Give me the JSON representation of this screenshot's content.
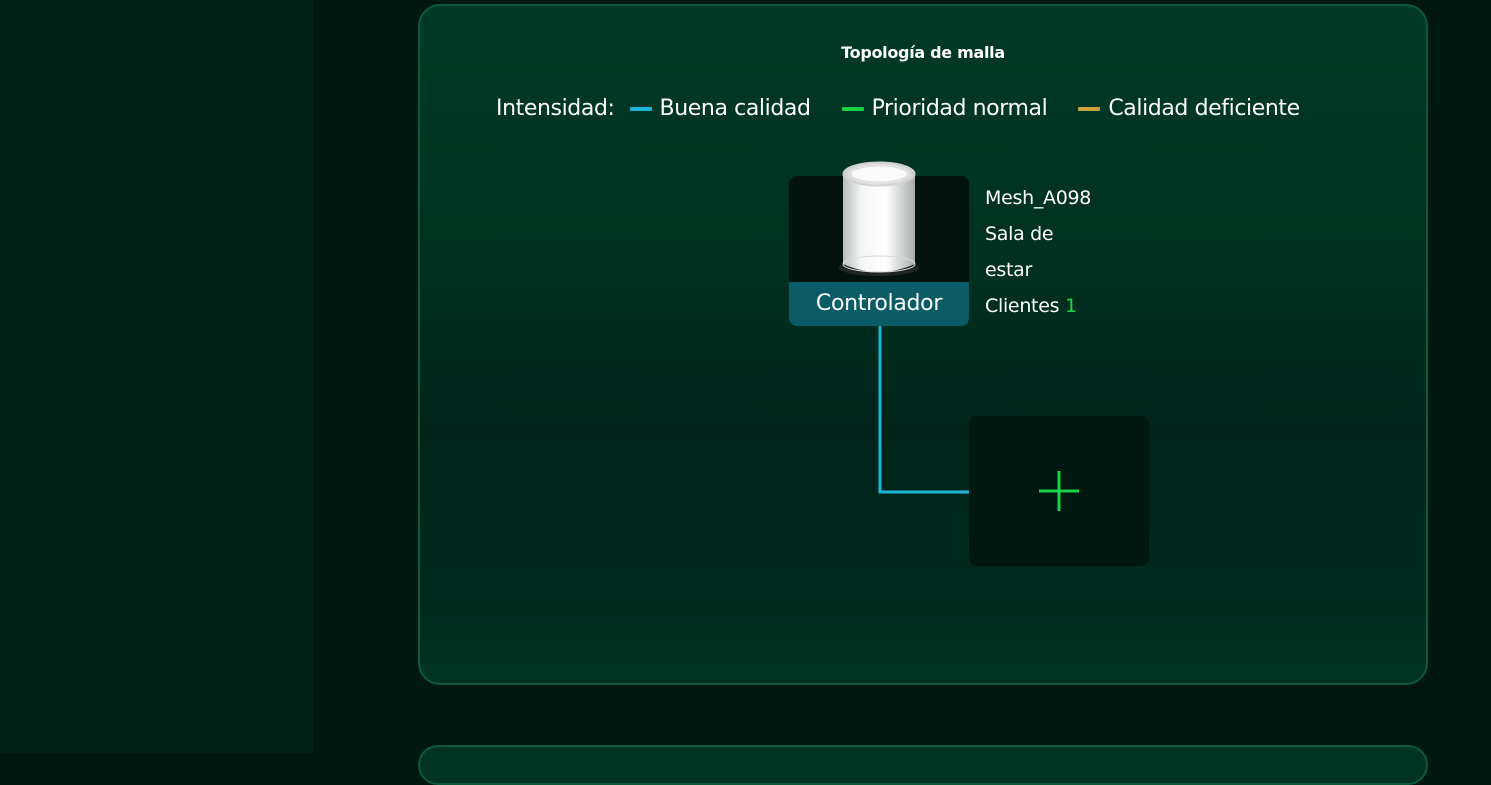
{
  "topology": {
    "title": "Topología de malla",
    "legend": {
      "label": "Intensidad:",
      "items": [
        {
          "label": "Buena calidad",
          "color": "#1eb3d9"
        },
        {
          "label": "Prioridad normal",
          "color": "#19d146"
        },
        {
          "label": "Calidad deficiente",
          "color": "#c9a43c"
        }
      ]
    },
    "controller": {
      "role_label": "Controlador",
      "name": "Mesh_A098",
      "location_line1": "Sala de",
      "location_line2": "estar",
      "clients_label": "Clientes",
      "clients_count": "1",
      "icon": "mesh-router-icon"
    },
    "link_color": "#1eb3d9",
    "add_node": {
      "icon": "plus-icon",
      "icon_color": "#19d146"
    }
  }
}
